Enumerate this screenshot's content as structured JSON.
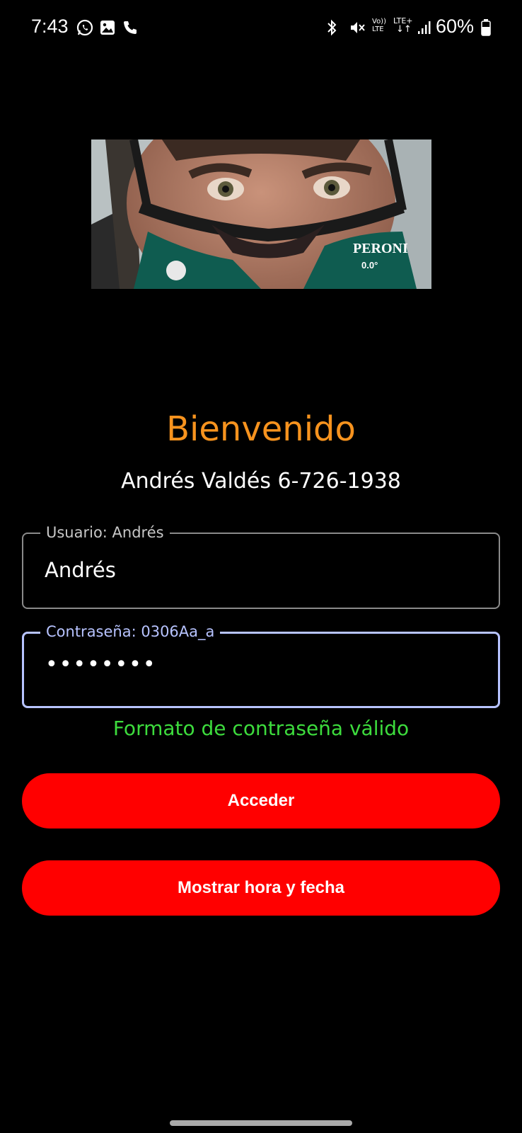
{
  "status_bar": {
    "time": "7:43",
    "battery_percent": "60%",
    "volte_label": "Vo)) LTE",
    "lte_label": "LTE+",
    "icons": [
      "whatsapp-icon",
      "gallery-icon",
      "phone-icon",
      "bluetooth-icon",
      "mute-vibrate-icon",
      "volte-icon",
      "lte-data-icon",
      "signal-icon",
      "battery-icon"
    ]
  },
  "photo": {
    "description": "profile-photo",
    "caption_text": "PERONI",
    "shirt_text": "0.0°"
  },
  "header": {
    "title": "Bienvenido",
    "subtitle": "Andrés Valdés 6-726-1938",
    "title_color": "#f7931e"
  },
  "form": {
    "username": {
      "label": "Usuario: Andrés",
      "value": "Andrés"
    },
    "password": {
      "label": "Contraseña: 0306Aa_a",
      "value": "••••••••",
      "focus_color": "#b7c3ff"
    },
    "validation_message": "Formato de contraseña válido",
    "validation_color": "#3ddc3d"
  },
  "buttons": {
    "access_label": "Acceder",
    "show_time_label": "Mostrar hora y fecha",
    "color": "#ff0000"
  }
}
